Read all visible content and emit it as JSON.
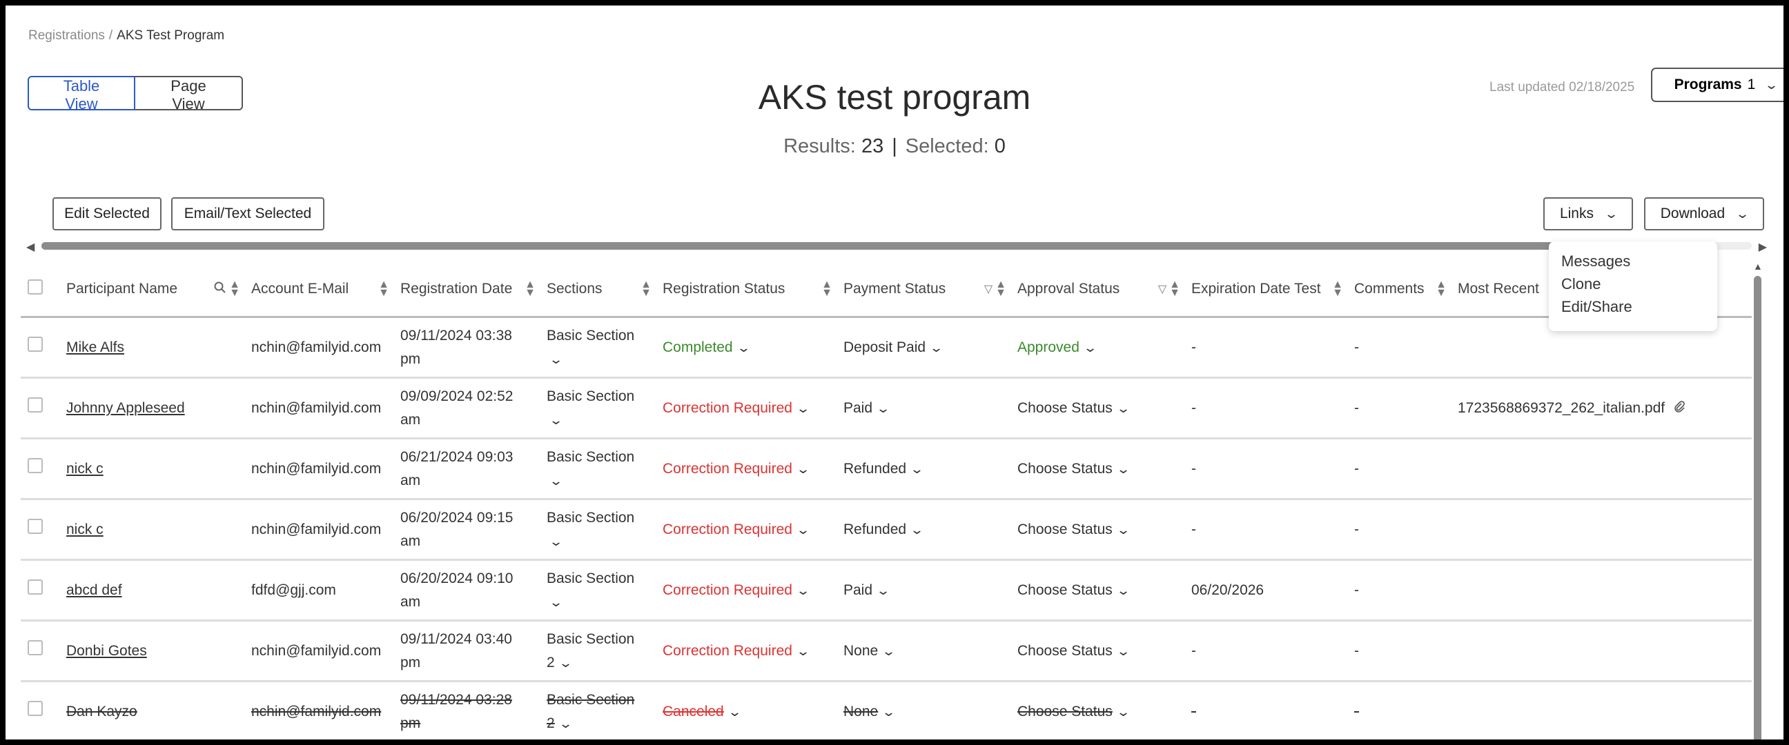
{
  "breadcrumb": {
    "root": "Registrations",
    "separator": "/",
    "current": "AKS Test Program"
  },
  "view_toggle": {
    "table_view": "Table View",
    "page_view": "Page View"
  },
  "title": "AKS test program",
  "results": {
    "results_label": "Results:",
    "results_count": "23",
    "pipe": "|",
    "selected_label": "Selected:",
    "selected_count": "0"
  },
  "last_updated": "Last updated 02/18/2025",
  "programs": {
    "label": "Programs",
    "count": "1"
  },
  "toolbar": {
    "edit_selected": "Edit Selected",
    "email_text_selected": "Email/Text Selected",
    "links": "Links",
    "download": "Download"
  },
  "links_menu": [
    "Messages",
    "Clone",
    "Edit/Share"
  ],
  "columns": {
    "participant_name": "Participant Name",
    "account_email": "Account E-Mail",
    "registration_date": "Registration Date",
    "sections": "Sections",
    "registration_status": "Registration Status",
    "payment_status": "Payment Status",
    "approval_status": "Approval Status",
    "expiration_date_test": "Expiration Date Test",
    "comments": "Comments",
    "most_recent": "Most Recent"
  },
  "rows": [
    {
      "name": "Mike Alfs",
      "email": "nchin@familyid.com",
      "date": "09/11/2024 03:38",
      "time": "pm",
      "section": "Basic Section",
      "section_num": "",
      "reg_status": "Completed",
      "pay_status": "Deposit Paid",
      "approval": "Approved",
      "expiration": "-",
      "comments": "-",
      "file": ""
    },
    {
      "name": "Johnny Appleseed",
      "email": "nchin@familyid.com",
      "date": "09/09/2024 02:52",
      "time": "am",
      "section": "Basic Section",
      "section_num": "",
      "reg_status": "Correction Required",
      "pay_status": "Paid",
      "approval": "Choose Status",
      "expiration": "-",
      "comments": "-",
      "file": "1723568869372_262_italian.pdf"
    },
    {
      "name": "nick c",
      "email": "nchin@familyid.com",
      "date": "06/21/2024 09:03",
      "time": "am",
      "section": "Basic Section",
      "section_num": "",
      "reg_status": "Correction Required",
      "pay_status": "Refunded",
      "approval": "Choose Status",
      "expiration": "-",
      "comments": "-",
      "file": ""
    },
    {
      "name": "nick c",
      "email": "nchin@familyid.com",
      "date": "06/20/2024 09:15",
      "time": "am",
      "section": "Basic Section",
      "section_num": "",
      "reg_status": "Correction Required",
      "pay_status": "Refunded",
      "approval": "Choose Status",
      "expiration": "-",
      "comments": "-",
      "file": ""
    },
    {
      "name": "abcd def",
      "email": "fdfd@gjj.com",
      "date": "06/20/2024 09:10",
      "time": "am",
      "section": "Basic Section",
      "section_num": "",
      "reg_status": "Correction Required",
      "pay_status": "Paid",
      "approval": "Choose Status",
      "expiration": "06/20/2026",
      "comments": "-",
      "file": ""
    },
    {
      "name": "Donbi Gotes",
      "email": "nchin@familyid.com",
      "date": "09/11/2024 03:40",
      "time": "pm",
      "section": "Basic Section",
      "section_num": "2",
      "reg_status": "Correction Required",
      "pay_status": "None",
      "approval": "Choose Status",
      "expiration": "-",
      "comments": "-",
      "file": ""
    },
    {
      "name": "Dan Kayzo",
      "email": "nchin@familyid.com",
      "date": "09/11/2024 03:28",
      "time": "pm",
      "section": "Basic Section",
      "section_num": "2",
      "reg_status": "Canceled",
      "pay_status": "None",
      "approval": "Choose Status",
      "expiration": "-",
      "comments": "-",
      "file": ""
    }
  ],
  "colors": {
    "accent": "#2c5ac4",
    "success": "#3b8a2a",
    "danger": "#dd3333"
  },
  "icons": {
    "search": "search-icon",
    "sort": "sort-icon",
    "filter": "filter-icon",
    "chevron": "chevron-down-icon",
    "attachment": "paperclip-icon"
  }
}
